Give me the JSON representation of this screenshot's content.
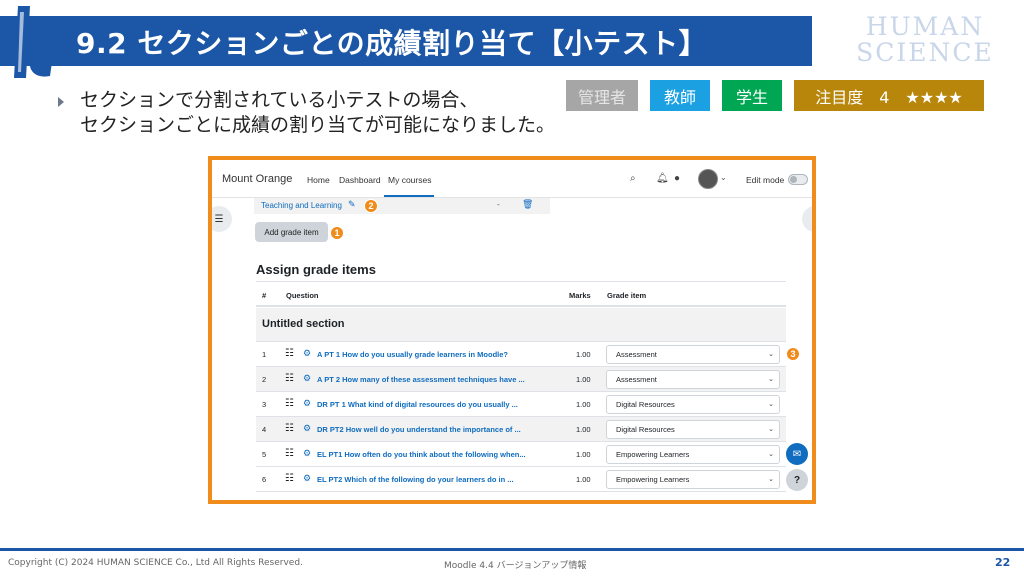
{
  "slide": {
    "title": "9.2 セクションごとの成績割り当て【小テスト】",
    "brand_line1": "HUMAN",
    "brand_line2": "SCIENCE",
    "bullet_line1": "セクションで分割されている小テストの場合、",
    "bullet_line2": "セクションごとに成績の割り当てが可能になりました。",
    "badges": {
      "admin": "管理者",
      "teacher": "教師",
      "student": "学生",
      "focus": "注目度　4　★★★★"
    },
    "colors": {
      "banner": "#1c56a6",
      "frame": "#f08c1c",
      "teacher": "#1ba1e2",
      "student": "#00a651",
      "focus": "#b8860b",
      "admin": "#a6a6a6"
    }
  },
  "moodle": {
    "site_name": "Mount Orange",
    "nav": {
      "home": "Home",
      "dashboard": "Dashboard",
      "my_courses": "My courses"
    },
    "edit_mode_label": "Edit mode",
    "category_link": "Teaching and Learning",
    "category_dash": "-",
    "add_grade_item": "Add grade item",
    "heading": "Assign grade items",
    "columns": {
      "num": "#",
      "question": "Question",
      "marks": "Marks",
      "grade_item": "Grade item"
    },
    "section_name": "Untitled section",
    "callouts": {
      "one": "1",
      "two": "2",
      "three": "3"
    },
    "questions": [
      {
        "num": "1",
        "text": "A PT 1 How do you usually grade learners in Moodle?",
        "marks": "1.00",
        "grade": "Assessment"
      },
      {
        "num": "2",
        "text": "A PT 2 How many of these assessment techniques have ...",
        "marks": "1.00",
        "grade": "Assessment"
      },
      {
        "num": "3",
        "text": "DR PT 1 What kind of digital resources do you usually ...",
        "marks": "1.00",
        "grade": "Digital Resources"
      },
      {
        "num": "4",
        "text": "DR PT2 How well do you understand the importance of ...",
        "marks": "1.00",
        "grade": "Digital Resources"
      },
      {
        "num": "5",
        "text": "EL PT1 How often do you think about the following when...",
        "marks": "1.00",
        "grade": "Empowering Learners"
      },
      {
        "num": "6",
        "text": "EL PT2 Which of the following do your learners do in ...",
        "marks": "1.00",
        "grade": "Empowering Learners"
      }
    ],
    "help_label": "?"
  },
  "footer": {
    "copyright": "Copyright (C) 2024 HUMAN SCIENCE Co., Ltd All Rights Reserved.",
    "center": "Moodle 4.4 バージョンアップ情報",
    "page": "22"
  }
}
